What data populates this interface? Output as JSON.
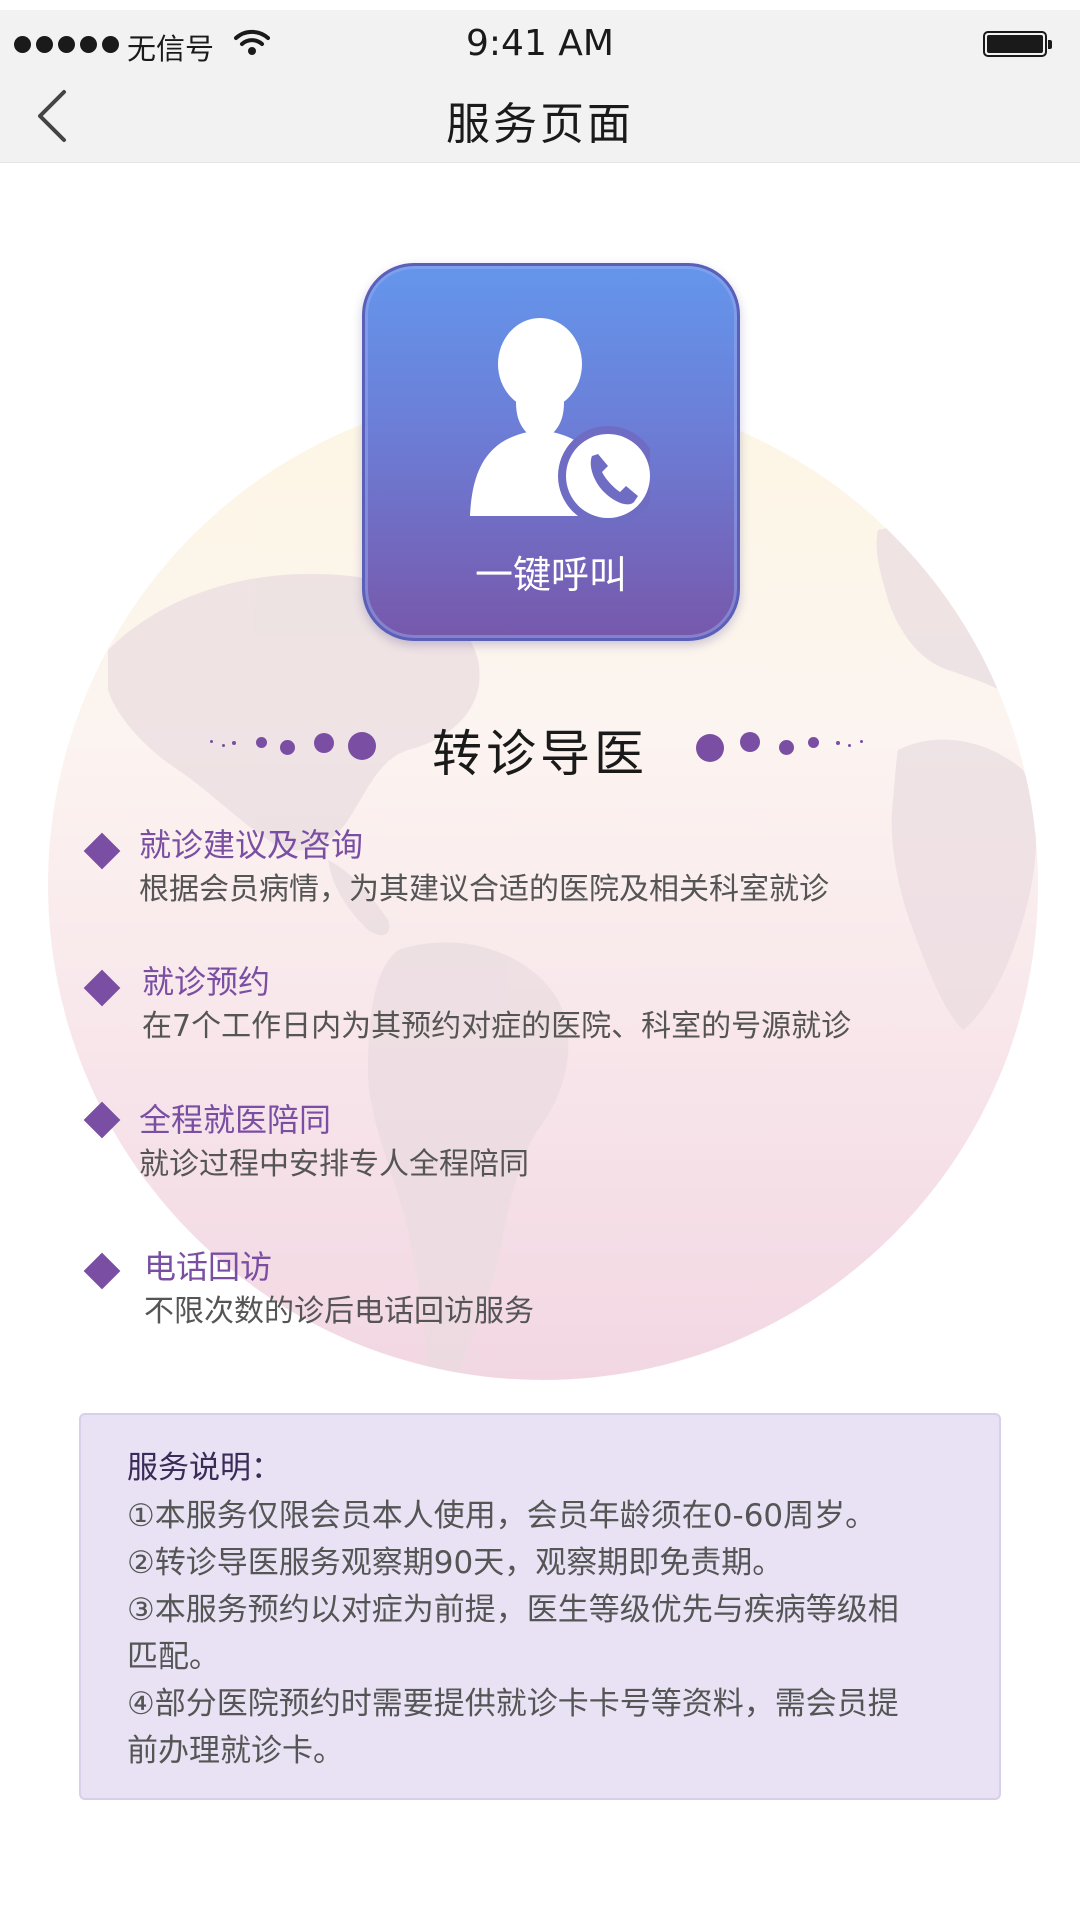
{
  "status_bar": {
    "carrier": "无信号",
    "time": "9:41 AM"
  },
  "nav": {
    "title": "服务页面"
  },
  "call_card": {
    "label": "一键呼叫"
  },
  "section": {
    "title": "转诊导医"
  },
  "features": [
    {
      "title": "就诊建议及咨询",
      "desc": "根据会员病情，为其建议合适的医院及相关科室就诊"
    },
    {
      "title": "就诊预约",
      "desc": "在7个工作日内为其预约对症的医院、科室的号源就诊"
    },
    {
      "title": "全程就医陪同",
      "desc": "就诊过程中安排专人全程陪同"
    },
    {
      "title": "电话回访",
      "desc": "不限次数的诊后电话回访服务"
    }
  ],
  "notes": {
    "title": "服务说明：",
    "lines": [
      "①本服务仅限会员本人使用，会员年龄须在0-60周岁。",
      "②转诊导医服务观察期90天，观察期即免责期。",
      "③本服务预约以对症为前提，医生等级优先与疾病等级相",
      "匹配。",
      "④部分医院预约时需要提供就诊卡卡号等资料，需会员提",
      "前办理就诊卡。"
    ]
  },
  "colors": {
    "accent": "#7a4fa3",
    "card_top": "#6496ec",
    "card_bottom": "#7758ab",
    "notes_bg": "#e9e2f4"
  }
}
